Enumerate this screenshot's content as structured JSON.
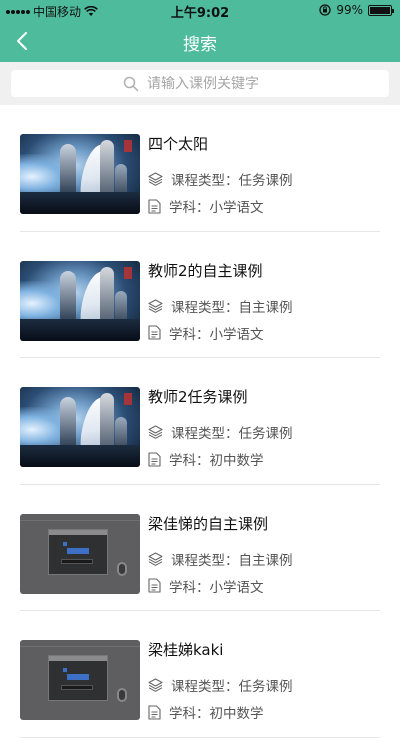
{
  "status_bar": {
    "carrier": "中国移动",
    "time": "上午9:02",
    "battery_text": "99%",
    "battery_level": 0.99
  },
  "nav": {
    "title": "搜索",
    "back_icon": "chevron-left-icon"
  },
  "search": {
    "placeholder": "请输入课例关键字",
    "value": ""
  },
  "colors": {
    "accent": "#4ebc9c",
    "search_bg": "#f0f0f0"
  },
  "results": [
    {
      "name": "四个太阳",
      "type_label": "课程类型：任务课例",
      "subject_label": "学科：小学语文",
      "thumb": "fantasy-art"
    },
    {
      "name": "教师2的自主课例",
      "type_label": "课程类型：自主课例",
      "subject_label": "学科：小学语文",
      "thumb": "fantasy-art"
    },
    {
      "name": "教师2任务课例",
      "type_label": "课程类型：任务课例",
      "subject_label": "学科：初中数学",
      "thumb": "fantasy-art"
    },
    {
      "name": "梁佳悌的自主课例",
      "type_label": "课程类型：自主课例",
      "subject_label": "学科：小学语文",
      "thumb": "desktop-screenshot"
    },
    {
      "name": "梁桂娣kaki",
      "type_label": "课程类型：任务课例",
      "subject_label": "学科：初中数学",
      "thumb": "desktop-screenshot"
    }
  ]
}
